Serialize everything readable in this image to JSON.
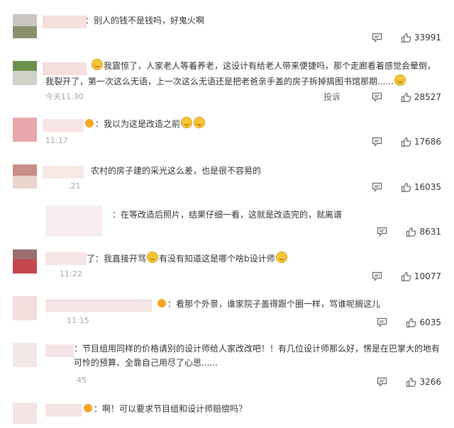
{
  "comments": [
    {
      "text": "：别人的钱不是钱吗，好鬼火啊",
      "time": "",
      "likes": "33991"
    },
    {
      "text": "我震惊了，人家老人等着养老，这设计有给老人带来便捷吗，那个走廊看着感觉会晕倒，我裂开了，第一次这么无语，上一次这么无语还是把老爸亲手盖的房子拆掉搞图书馆那期......",
      "time": "今天11:30",
      "report": "投诉",
      "likes": "28527"
    },
    {
      "text": "：我以为这是改造之前",
      "time": "11:17",
      "likes": "17686"
    },
    {
      "text": "农村的房子建的采光这么差，也是很不容易的",
      "time": ".21",
      "likes": "16035"
    },
    {
      "text": "：在等改造后照片，结果仔细一看，这就是改造完的，就离谱",
      "time": "",
      "likes": "8631"
    },
    {
      "name_tail": "了",
      "text_a": "：我直接开骂",
      "text_b": "有没有知道这是哪个啥b设计师",
      "time": "11:22",
      "likes": "10077"
    },
    {
      "text": "：看那个外景，谁家院子盖得跟个圈一样，骂谁呢搁这儿",
      "time": "11:15",
      "likes": "6035"
    },
    {
      "text": "：节目组用同样的价格请别的设计师给人家改改吧！！有几位设计师那么好，愣是在巴掌大的地有可怜的预算、全靠自己用尽了心思......",
      "time": "45",
      "likes": "3266"
    },
    {
      "text": "：啊！可以要求节目组和设计师赔偿吗？",
      "time": "",
      "likes": ""
    }
  ],
  "colors": {
    "text": "#333333",
    "meta": "#a8a8a8",
    "icon": "#666666",
    "emoji": "#f7c637",
    "badge": "#f5a623"
  },
  "icons": {
    "comment": "comment-icon",
    "like": "thumbs-up-icon",
    "emoji": "smiley-emoji-icon",
    "badge": "verified-badge-icon"
  }
}
